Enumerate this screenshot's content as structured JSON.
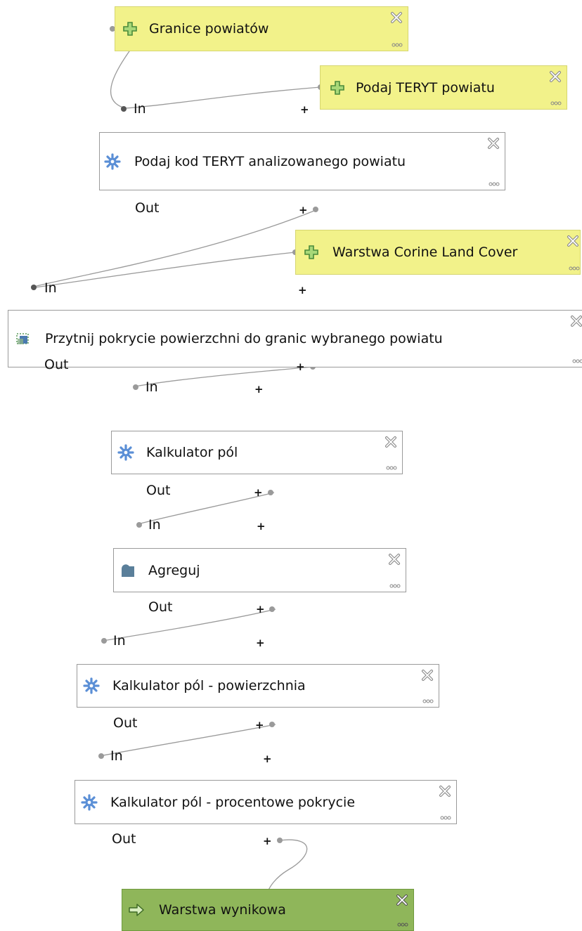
{
  "nodes": {
    "granice": {
      "label": "Granice powiatów",
      "kind": "input",
      "icon": "plus-icon"
    },
    "podaj_teryt": {
      "label": "Podaj TERYT powiatu",
      "kind": "input",
      "icon": "plus-icon"
    },
    "podaj_kod": {
      "label": "Podaj kod TERYT analizowanego powiatu",
      "kind": "algorithm",
      "icon": "gear-icon"
    },
    "corine": {
      "label": "Warstwa Corine Land Cover",
      "kind": "input",
      "icon": "plus-icon"
    },
    "przytnij": {
      "label": "Przytnij pokrycie powierzchni do granic wybranego powiatu",
      "kind": "algorithm",
      "icon": "clip-icon"
    },
    "kalk1": {
      "label": "Kalkulator pól",
      "kind": "algorithm",
      "icon": "gear-icon"
    },
    "agreguj": {
      "label": "Agreguj",
      "kind": "algorithm",
      "icon": "aggregate-icon"
    },
    "kalk2": {
      "label": "Kalkulator pól - powierzchnia",
      "kind": "algorithm",
      "icon": "gear-icon"
    },
    "kalk3": {
      "label": "Kalkulator pól - procentowe pokrycie",
      "kind": "algorithm",
      "icon": "gear-icon"
    },
    "wynik": {
      "label": "Warstwa wynikowa",
      "kind": "output",
      "icon": "arrow-right-icon"
    }
  },
  "ports": {
    "in": "In",
    "out": "Out",
    "expand": "+"
  },
  "colors": {
    "input_fill": "#f2f28a",
    "output_fill": "#8fb65a",
    "link": "#9a9a9a",
    "gear": "#5b8fd6"
  }
}
